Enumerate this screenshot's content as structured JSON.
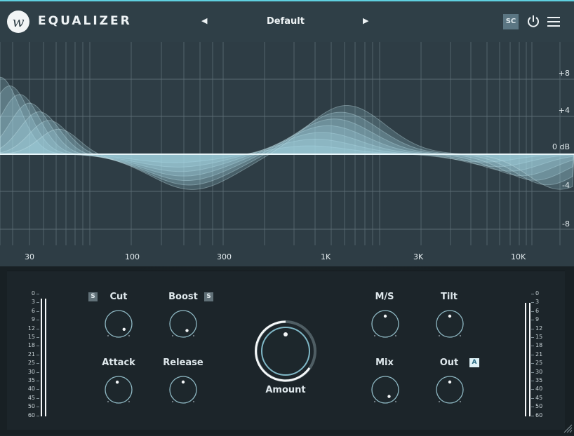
{
  "header": {
    "logo_letter": "w",
    "title": "EQUALIZER",
    "preset": "Default",
    "prev_glyph": "◀",
    "next_glyph": "▶",
    "sidechain_label": "SC",
    "icons": [
      "power-icon",
      "menu-icon"
    ]
  },
  "graph": {
    "db_labels": [
      "+8",
      "+4",
      "0 dB",
      "-4",
      "-8"
    ],
    "freq_labels": [
      "30",
      "100",
      "300",
      "1K",
      "3K",
      "10K"
    ],
    "colors": {
      "background": "#2e3d45",
      "curve": "#a9d9e6",
      "gridline": "#5b6c74"
    }
  },
  "meters": {
    "scale": [
      "0",
      "3",
      "6",
      "9",
      "12",
      "15",
      "18",
      "21",
      "25",
      "30",
      "35",
      "40",
      "45",
      "50",
      "60"
    ]
  },
  "controls": {
    "cut": {
      "label": "Cut",
      "badge": "S"
    },
    "boost": {
      "label": "Boost",
      "badge": "S"
    },
    "attack": {
      "label": "Attack"
    },
    "release": {
      "label": "Release"
    },
    "amount": {
      "label": "Amount"
    },
    "ms": {
      "label": "M/S"
    },
    "tilt": {
      "label": "Tilt"
    },
    "mix": {
      "label": "Mix"
    },
    "out": {
      "label": "Out",
      "badge": "A"
    }
  },
  "colors": {
    "accent": "#5fd0e0",
    "panel": "#1c252a",
    "header": "#2f3f47"
  }
}
